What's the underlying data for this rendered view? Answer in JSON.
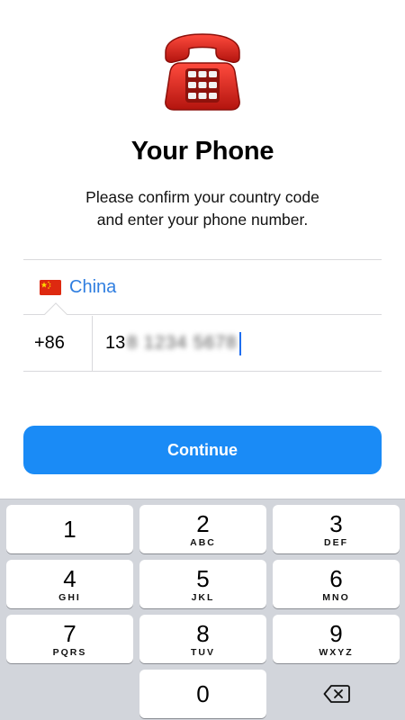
{
  "header": {
    "icon": "red-telephone-icon",
    "title": "Your Phone",
    "subtitle_line1": "Please confirm your country code",
    "subtitle_line2": "and enter your phone number."
  },
  "country": {
    "flag_icon": "china-flag-icon",
    "name": "China"
  },
  "phone": {
    "country_code": "+86",
    "number_visible": "13",
    "number_obscured": "8 1234 5678"
  },
  "continue_label": "Continue",
  "keyboard": {
    "keys": [
      {
        "digit": "1",
        "letters": ""
      },
      {
        "digit": "2",
        "letters": "ABC"
      },
      {
        "digit": "3",
        "letters": "DEF"
      },
      {
        "digit": "4",
        "letters": "GHI"
      },
      {
        "digit": "5",
        "letters": "JKL"
      },
      {
        "digit": "6",
        "letters": "MNO"
      },
      {
        "digit": "7",
        "letters": "PQRS"
      },
      {
        "digit": "8",
        "letters": "TUV"
      },
      {
        "digit": "9",
        "letters": "WXYZ"
      },
      {
        "digit": "0",
        "letters": ""
      }
    ],
    "delete_icon": "backspace-icon"
  },
  "colors": {
    "accent": "#1a8bf6",
    "link": "#2f7ee0",
    "phone_red": "#d9241c",
    "keyboard_bg": "#d2d5db"
  }
}
